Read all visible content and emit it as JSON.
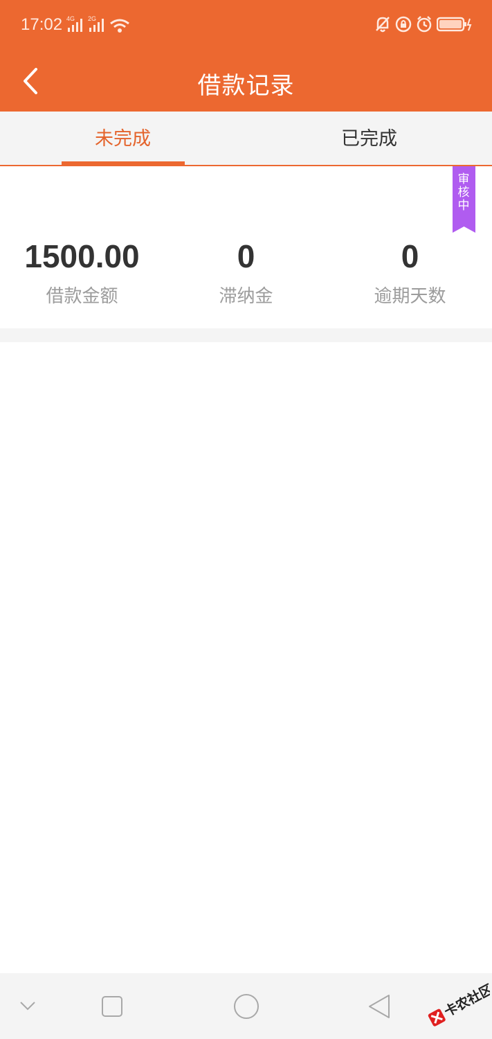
{
  "status_bar": {
    "time": "17:02",
    "signal_1_label": "4G",
    "signal_2_label": "2G",
    "icons": [
      "signal-icon",
      "signal-icon",
      "wifi-icon",
      "bell-muted-icon",
      "lock-rotation-icon",
      "alarm-icon",
      "battery-charging-icon"
    ]
  },
  "header": {
    "title": "借款记录",
    "back_icon": "chevron-left-icon"
  },
  "tabs": [
    {
      "label": "未完成",
      "active": true
    },
    {
      "label": "已完成",
      "active": false
    }
  ],
  "loan_card": {
    "status_ribbon": "审核中",
    "stats": [
      {
        "value": "1500.00",
        "label": "借款金额"
      },
      {
        "value": "0",
        "label": "滞纳金"
      },
      {
        "value": "0",
        "label": "逾期天数"
      }
    ]
  },
  "nav_bar": {
    "buttons": [
      "chevron-down-icon",
      "recent-apps-icon",
      "home-icon",
      "back-triangle-icon"
    ]
  },
  "watermark": {
    "text": "卡农社区"
  },
  "colors": {
    "primary": "#ec6830",
    "ribbon": "#b05cf0",
    "stat_value": "#333333",
    "stat_label": "#9c9c9c"
  }
}
